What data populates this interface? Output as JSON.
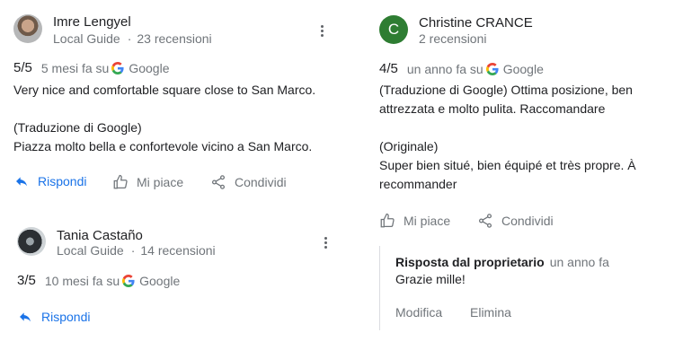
{
  "reviews": [
    {
      "author": "Imre Lengyel",
      "author_meta": "Local Guide",
      "review_count": "23 recensioni",
      "score": "5/5",
      "time": "5 mesi fa su",
      "source": "Google",
      "lines": [
        "Very nice and comfortable square close to San Marco.",
        "",
        "(Traduzione di Google)",
        "Piazza molto bella e confortevole vicino a San Marco."
      ],
      "actions": [
        "Rispondi",
        "Mi piace",
        "Condividi"
      ]
    },
    {
      "author": "Tania Castaño",
      "author_meta": "Local Guide",
      "review_count": "14 recensioni",
      "score": "3/5",
      "time": "10 mesi fa su",
      "source": "Google",
      "actions": [
        "Rispondi"
      ]
    },
    {
      "author": "Christine CRANCE",
      "avatar_letter": "C",
      "review_count": "2 recensioni",
      "score": "4/5",
      "time": "un anno fa su",
      "source": "Google",
      "lines": [
        "(Traduzione di Google) Ottima posizione, ben",
        "attrezzata e molto pulita. Raccomandare",
        "",
        "(Originale)",
        "Super bien situé, bien équipé et très propre. À",
        "recommander"
      ],
      "actions": [
        "Mi piace",
        "Condividi"
      ],
      "owner_reply": {
        "title": "Risposta dal proprietario",
        "time": "un anno fa",
        "text": "Grazie mille!",
        "edit": "Modifica",
        "delete": "Elimina"
      }
    }
  ],
  "colors": {
    "link_blue": "#1a73e8",
    "meta_grey": "#70757a",
    "avatar_green": "#2e7d32"
  }
}
